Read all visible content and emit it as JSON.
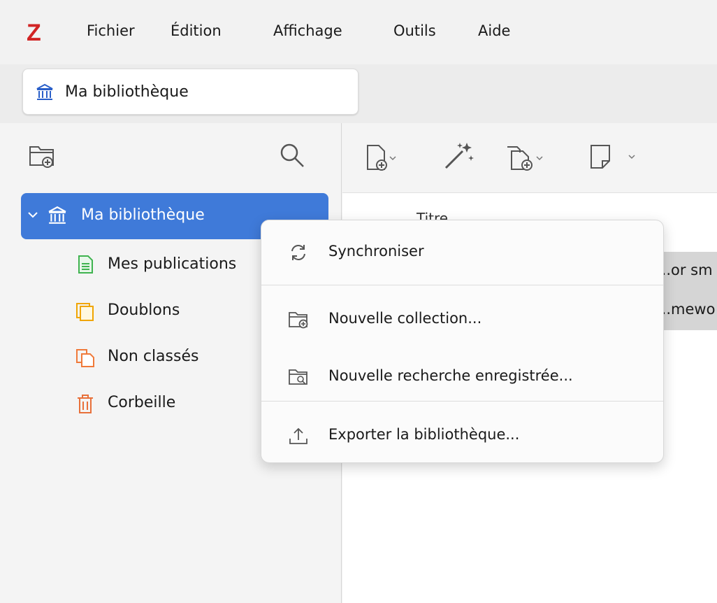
{
  "menubar": {
    "logo": "Z",
    "items": [
      "Fichier",
      "Édition",
      "Affichage",
      "Outils",
      "Aide"
    ]
  },
  "tab": {
    "label": "Ma bibliothèque"
  },
  "tree": {
    "library": "Ma bibliothèque",
    "items": [
      "Mes publications",
      "Doublons",
      "Non classés",
      "Corbeille"
    ]
  },
  "items_pane": {
    "column_header": "Titre",
    "rows": [
      "...or sm",
      "...mewo"
    ]
  },
  "context_menu": {
    "items": [
      "Synchroniser",
      "Nouvelle collection...",
      "Nouvelle recherche enregistrée...",
      "Exporter la bibliothèque..."
    ]
  },
  "colors": {
    "accent": "#3f7ad9",
    "logo": "#d12424",
    "publications_icon": "#3fb34f",
    "duplicates_icon": "#f0a500",
    "unfiled_icon": "#f07a3a",
    "trash_icon": "#e8703a"
  }
}
